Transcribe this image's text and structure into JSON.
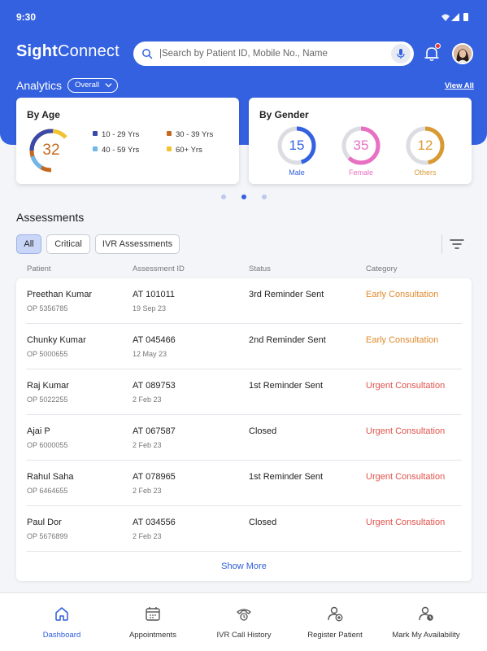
{
  "status_bar": {
    "time": "9:30"
  },
  "header": {
    "logo_bold": "Sight",
    "logo_rest": "Connect",
    "search_placeholder": "|Search by Patient ID, Mobile No., Name",
    "accent_color": "#3461e0"
  },
  "analytics": {
    "title": "Analytics",
    "filter_value": "Overall",
    "view_all": "View All",
    "age_card": {
      "title": "By Age",
      "value": "32",
      "legend": [
        {
          "label": "10 - 29 Yrs",
          "color": "#3b4aa8"
        },
        {
          "label": "30 - 39 Yrs",
          "color": "#c4691f"
        },
        {
          "label": "40 - 59 Yrs",
          "color": "#6fb6e9"
        },
        {
          "label": "60+ Yrs",
          "color": "#f2c230"
        }
      ]
    },
    "gender_card": {
      "title": "By Gender",
      "items": [
        {
          "value": "15",
          "label": "Male",
          "color": "#3461e0"
        },
        {
          "value": "35",
          "label": "Female",
          "color": "#e86fc2"
        },
        {
          "value": "12",
          "label": "Others",
          "color": "#d99a34"
        }
      ]
    }
  },
  "assessments": {
    "title": "Assessments",
    "filters": [
      "All",
      "Critical",
      "IVR Assessments"
    ],
    "active_filter": "All",
    "columns": [
      "Patient",
      "Assessment ID",
      "Status",
      "Category"
    ],
    "rows": [
      {
        "name": "Preethan Kumar",
        "op": "OP 5356785",
        "id": "AT 101011",
        "date": "19 Sep 23",
        "status": "3rd Reminder Sent",
        "category": "Early Consultation",
        "category_color": "#e08a2c"
      },
      {
        "name": "Chunky Kumar",
        "op": "OP 5000655",
        "id": "AT 045466",
        "date": "12 May 23",
        "status": "2nd Reminder Sent",
        "category": "Early Consultation",
        "category_color": "#e08a2c"
      },
      {
        "name": "Raj Kumar",
        "op": "OP 5022255",
        "id": "AT 089753",
        "date": "2 Feb 23",
        "status": "1st Reminder Sent",
        "category": "Urgent Consultation",
        "category_color": "#e0524a"
      },
      {
        "name": "Ajai P",
        "op": "OP 6000055",
        "id": "AT 067587",
        "date": "2 Feb 23",
        "status": "Closed",
        "category": "Urgent Consultation",
        "category_color": "#e0524a"
      },
      {
        "name": "Rahul Saha",
        "op": "OP 6464655",
        "id": "AT 078965",
        "date": "2 Feb 23",
        "status": "1st Reminder Sent",
        "category": "Urgent Consultation",
        "category_color": "#e0524a"
      },
      {
        "name": "Paul Dor",
        "op": "OP 5676899",
        "id": "AT 034556",
        "date": "2 Feb 23",
        "status": "Closed",
        "category": "Urgent Consultation",
        "category_color": "#e0524a"
      }
    ],
    "show_more": "Show More"
  },
  "bottom_nav": {
    "items": [
      {
        "label": "Dashboard",
        "icon": "home-icon"
      },
      {
        "label": "Appointments",
        "icon": "calendar-icon"
      },
      {
        "label": "IVR Call History",
        "icon": "phone-history-icon"
      },
      {
        "label": "Register Patient",
        "icon": "add-user-icon"
      },
      {
        "label": "Mark My Availability",
        "icon": "user-clock-icon"
      }
    ],
    "active": "Dashboard"
  }
}
